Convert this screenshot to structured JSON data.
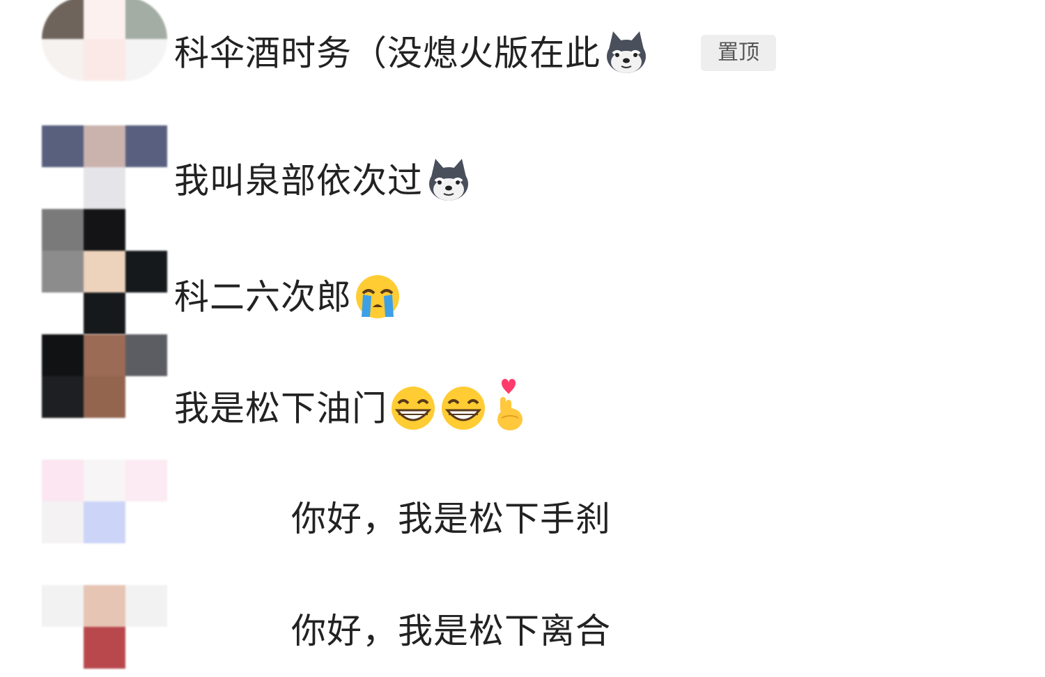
{
  "chat_list": {
    "items": [
      {
        "name": "科伞酒时务（没熄火版在此",
        "emoji": [
          "husky-dog-emoji"
        ],
        "badge": "置顶",
        "avatar_colors": [
          "#6e645c",
          "#fdf1ef",
          "#a3ada4",
          "#f6f2f0",
          "#fbe9e8",
          "#f4f4f4"
        ]
      },
      {
        "name": "我叫泉部依次过",
        "emoji": [
          "husky-dog-emoji"
        ],
        "avatar_colors": [
          "#58607e",
          "#cab2ad",
          "#59607f",
          "#ffffff",
          "#e5e4e8",
          "#ffffff"
        ]
      },
      {
        "name": "科二六次郎",
        "emoji": [
          "crying-face-emoji"
        ],
        "avatar_colors": [
          "#7a7a7a",
          "#141416",
          "#ffffff",
          "#8c8c8c",
          "#eed3bc",
          "#15191b"
        ]
      },
      {
        "name": "我是松下油门",
        "emoji": [
          "grinning-face-emoji",
          "grinning-face-emoji",
          "finger-heart-emoji"
        ],
        "avatar_colors": [
          "#111214",
          "#9b6b56",
          "#5c5d63",
          "#1e1f22",
          "#93654e",
          "#ffffff"
        ]
      },
      {
        "name": "你好，我是松下手刹",
        "emoji": [],
        "avatar_colors": [
          "#fbe6f1",
          "#f7f5f5",
          "#fcebf3",
          "#f4f2f2",
          "#ccd4f8",
          "#ffffff"
        ]
      },
      {
        "name": "你好，我是松下离合",
        "emoji": [],
        "avatar_colors": [
          "#f2f2f2",
          "#e6c5b5",
          "#f2f2f2",
          "#ffffff",
          "#b9484c",
          "#ffffff"
        ]
      }
    ]
  }
}
